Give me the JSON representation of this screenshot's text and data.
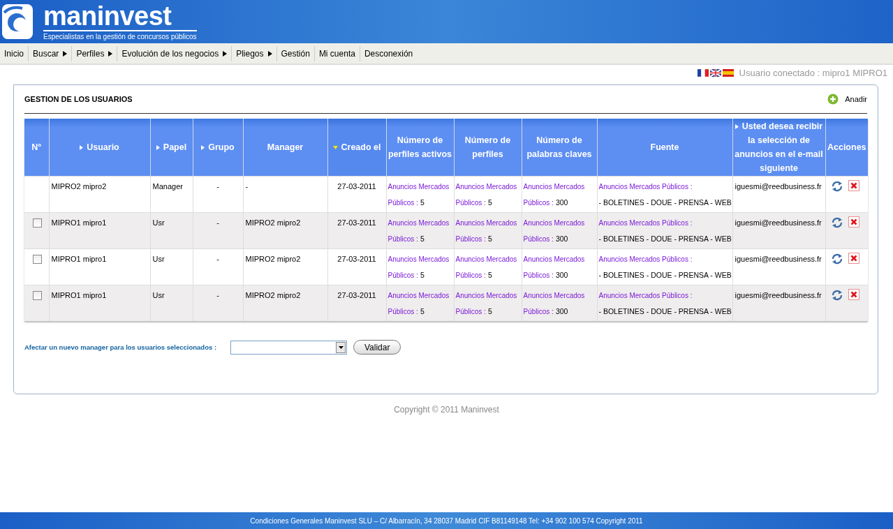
{
  "header": {
    "logo_text": "maninvest",
    "tagline": "Especialistas en la gestión de concursos públicos"
  },
  "nav": [
    {
      "label": "Inicio",
      "has_submenu": false
    },
    {
      "label": "Buscar",
      "has_submenu": true
    },
    {
      "label": "Perfiles",
      "has_submenu": true
    },
    {
      "label": "Evolución de los negocios",
      "has_submenu": true
    },
    {
      "label": "Pliegos",
      "has_submenu": true
    },
    {
      "label": "Gestión",
      "has_submenu": false
    },
    {
      "label": "Mi cuenta",
      "has_submenu": false
    },
    {
      "label": "Desconexión",
      "has_submenu": false
    }
  ],
  "languages": [
    {
      "kind": "fr"
    },
    {
      "kind": "en"
    },
    {
      "kind": "es"
    }
  ],
  "user_status": "Usuario conectado : mipro1 MIPRO1",
  "panel": {
    "title": "GESTION DE LOS USUARIOS",
    "add_label": "Anadir"
  },
  "table": {
    "columns": [
      {
        "label": "N°",
        "sortable": false,
        "sorted": false
      },
      {
        "label": "Usuario",
        "sortable": true,
        "sorted": false
      },
      {
        "label": "Papel",
        "sortable": true,
        "sorted": false
      },
      {
        "label": "Grupo",
        "sortable": true,
        "sorted": false
      },
      {
        "label": "Manager",
        "sortable": false,
        "sorted": false
      },
      {
        "label": "Creado el",
        "sorted": true
      },
      {
        "label": "Número de perfiles activos",
        "sortable": false,
        "sorted": false
      },
      {
        "label": "Número de perfiles",
        "sortable": false,
        "sorted": false
      },
      {
        "label": "Número de palabras claves",
        "sortable": false,
        "sorted": false
      },
      {
        "label": "Fuente",
        "sortable": false,
        "sorted": false
      },
      {
        "label": "Usted desea recibir la selección de anuncios en el e-mail siguiente",
        "sortable": true,
        "sorted": false
      },
      {
        "label": "Acciones",
        "sortable": false,
        "sorted": false
      }
    ],
    "rows": [
      {
        "selectable": false,
        "usuario": "MIPRO2 mipro2",
        "papel": "Manager",
        "grupo": "-",
        "manager": "-",
        "creado": "27-03-2011",
        "perfiles_activos": {
          "label": "Anuncios Mercados Públicos :",
          "value": "5"
        },
        "perfiles": {
          "label": "Anuncios Mercados Públicos :",
          "value": "5"
        },
        "palabras": {
          "label": "Anuncios Mercados Públicos :",
          "value": "300"
        },
        "fuente": {
          "label": "Anuncios Mercados Públicos :",
          "value": "- BOLETINES - DOUE - PRENSA - WEB"
        },
        "email": "iguesmi@reedbusiness.fr"
      },
      {
        "selectable": true,
        "checked": false,
        "usuario": "MIPRO1 mipro1",
        "papel": "Usr",
        "grupo": "-",
        "manager": "MIPRO2 mipro2",
        "creado": "27-03-2011",
        "perfiles_activos": {
          "label": "Anuncios Mercados Públicos :",
          "value": "5"
        },
        "perfiles": {
          "label": "Anuncios Mercados Públicos :",
          "value": "5"
        },
        "palabras": {
          "label": "Anuncios Mercados Públicos :",
          "value": "300"
        },
        "fuente": {
          "label": "Anuncios Mercados Públicos :",
          "value": "- BOLETINES - DOUE - PRENSA - WEB"
        },
        "email": "iguesmi@reedbusiness.fr"
      },
      {
        "selectable": true,
        "checked": false,
        "usuario": "MIPRO1 mipro1",
        "papel": "Usr",
        "grupo": "-",
        "manager": "MIPRO2 mipro2",
        "creado": "27-03-2011",
        "perfiles_activos": {
          "label": "Anuncios Mercados Públicos :",
          "value": "5"
        },
        "perfiles": {
          "label": "Anuncios Mercados Públicos :",
          "value": "5"
        },
        "palabras": {
          "label": "Anuncios Mercados Públicos :",
          "value": "300"
        },
        "fuente": {
          "label": "Anuncios Mercados Públicos :",
          "value": "- BOLETINES - DOUE - PRENSA - WEB"
        },
        "email": "iguesmi@reedbusiness.fr"
      },
      {
        "selectable": true,
        "checked": false,
        "usuario": "MIPRO1 mipro1",
        "papel": "Usr",
        "grupo": "-",
        "manager": "MIPRO2 mipro2",
        "creado": "27-03-2011",
        "perfiles_activos": {
          "label": "Anuncios Mercados Públicos :",
          "value": "5"
        },
        "perfiles": {
          "label": "Anuncios Mercados Públicos :",
          "value": "5"
        },
        "palabras": {
          "label": "Anuncios Mercados Públicos :",
          "value": "300"
        },
        "fuente": {
          "label": "Anuncios Mercados Públicos :",
          "value": "- BOLETINES - DOUE - PRENSA - WEB"
        },
        "email": "iguesmi@reedbusiness.fr"
      }
    ]
  },
  "assign": {
    "label": "Afectar un nuevo manager para los usuarios seleccionados :",
    "button": "Validar"
  },
  "copyright": "Copyright © 2011 Maninvest",
  "footer": "Condiciones Generales Maninvest SLU – C/ Albarracín, 34 28037 Madrid CIF B81149148 Tel: +34 902 100 574 Copyright 2011"
}
